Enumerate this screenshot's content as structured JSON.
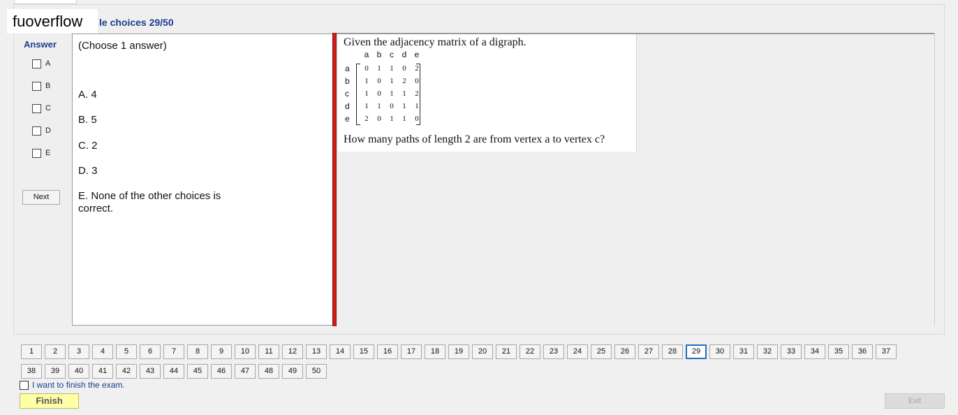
{
  "header": {
    "brand": "fuoverflow",
    "title_fragment": "le choices 29/50"
  },
  "answer_panel": {
    "label": "Answer",
    "options": [
      "A",
      "B",
      "C",
      "D",
      "E"
    ],
    "next_label": "Next"
  },
  "choices": {
    "hint": "(Choose 1 answer)",
    "items": [
      "A. 4",
      "B. 5",
      "C. 2",
      "D. 3",
      "E. None of the other choices is correct."
    ]
  },
  "question": {
    "intro": "Given the adjacency matrix of a digraph.",
    "matrix": {
      "col_labels": [
        "a",
        "b",
        "c",
        "d",
        "e"
      ],
      "row_labels": [
        "a",
        "b",
        "c",
        "d",
        "e"
      ],
      "rows": [
        [
          "0",
          "1",
          "1",
          "0",
          "2"
        ],
        [
          "1",
          "0",
          "1",
          "2",
          "0"
        ],
        [
          "1",
          "0",
          "1",
          "1",
          "2"
        ],
        [
          "1",
          "1",
          "0",
          "1",
          "1"
        ],
        [
          "2",
          "0",
          "1",
          "1",
          "0"
        ]
      ]
    },
    "text": "How many paths of length 2 are from vertex a to vertex c?"
  },
  "navigation": {
    "pages": [
      "1",
      "2",
      "3",
      "4",
      "5",
      "6",
      "7",
      "8",
      "9",
      "10",
      "11",
      "12",
      "13",
      "14",
      "15",
      "16",
      "17",
      "18",
      "19",
      "20",
      "21",
      "22",
      "23",
      "24",
      "25",
      "26",
      "27",
      "28",
      "29",
      "30",
      "31",
      "32",
      "33",
      "34",
      "35",
      "36",
      "37",
      "38",
      "39",
      "40",
      "41",
      "42",
      "43",
      "44",
      "45",
      "46",
      "47",
      "48",
      "49",
      "50"
    ],
    "current": "29"
  },
  "footer": {
    "finish_checkbox_label": "I want to finish the exam.",
    "finish_label": "Finish",
    "exit_label": "Exit"
  }
}
